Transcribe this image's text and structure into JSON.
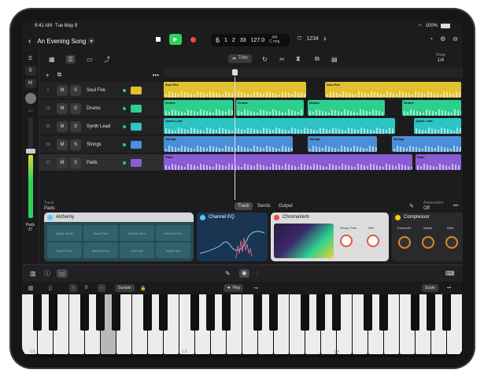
{
  "status": {
    "time": "9:41 AM",
    "date": "Tue May 9",
    "battery": "100%"
  },
  "project": {
    "title": "An Evening Song"
  },
  "lcd": {
    "bar": "6",
    "beat": "1",
    "sub": "2",
    "tick": "33",
    "tempo": "127.0",
    "signature": "4/4",
    "key": "C maj",
    "count_in": "1234"
  },
  "toolbar": {
    "trim": "Trim",
    "snap_label": "Snap",
    "snap_value": "1/4"
  },
  "tracks": [
    {
      "num": "1",
      "name": "Soul Fire",
      "color": "#e2c12e"
    },
    {
      "num": "18",
      "name": "Drums",
      "color": "#2ecf8d"
    },
    {
      "num": "35",
      "name": "Synth Lead",
      "color": "#2ec4c4"
    },
    {
      "num": "36",
      "name": "Strings",
      "color": "#4a8fd8"
    },
    {
      "num": "37",
      "name": "Pads",
      "color": "#8a5cd6"
    }
  ],
  "regions": {
    "soulfire": [
      "Soul Fire",
      "Soul Fire"
    ],
    "drums": [
      "Drums",
      "Drums",
      "Drums",
      "Drums"
    ],
    "synth": [
      "Synth Lead",
      "Synth Lead"
    ],
    "strings": [
      "Strings",
      "Strings",
      "Strings"
    ],
    "pads": [
      "Pads",
      "Pads"
    ]
  },
  "mute_label": "M",
  "solo_label": "S",
  "track_info": {
    "label": "Track",
    "value": "Pads",
    "tabs": [
      "Track",
      "Sends",
      "Output"
    ],
    "automation_label": "Automation",
    "automation_value": "Off"
  },
  "volume": {
    "db": "-4.7",
    "name": "Pads",
    "num": "37"
  },
  "plugins": {
    "alchemy": {
      "name": "Alchemy",
      "pads": [
        "Bright Synth",
        "Synth Fluff",
        "Metallic Beat",
        "Mirrored Pad",
        "Synth Pluck",
        "Mirrored Arp",
        "Dark Arp",
        "Bright Arp"
      ]
    },
    "eq": {
      "name": "Channel EQ"
    },
    "verb": {
      "name": "ChromaVerb",
      "decay": "Decay Time",
      "wet": "Wet"
    },
    "comp": {
      "name": "Compressor",
      "threshold": "Threshold",
      "attack": "Attack",
      "release": "Rele"
    }
  },
  "keyboard_bar": {
    "octave": "0",
    "sustain": "Sustain",
    "play": "Play",
    "scale": "Scale"
  },
  "octaves": [
    "C2",
    "C3",
    "C4"
  ],
  "colors": {
    "play": "#30d158",
    "record": "#ff453a",
    "accent": "#0a84ff"
  }
}
